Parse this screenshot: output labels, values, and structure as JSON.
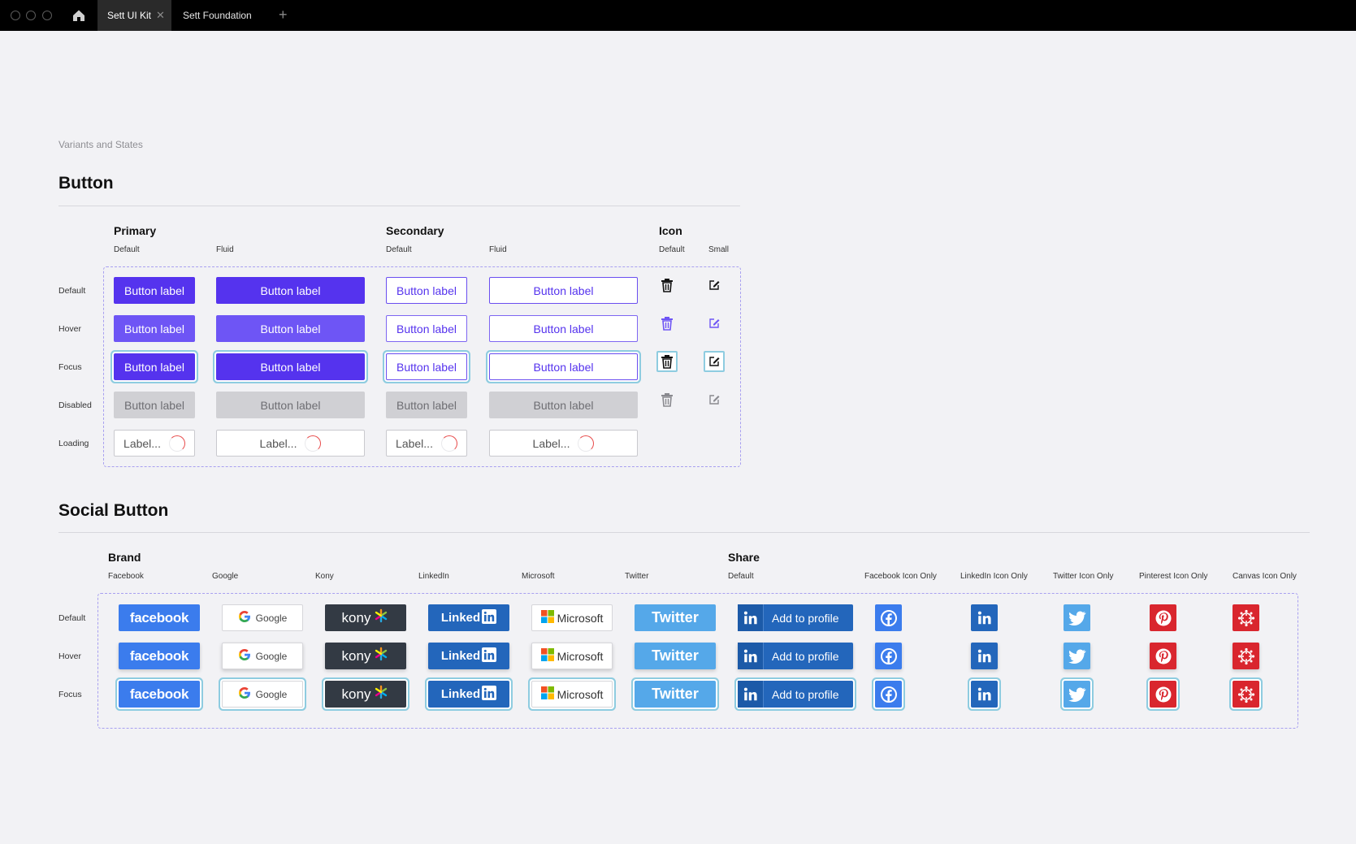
{
  "tabs": [
    {
      "label": "Sett UI Kit",
      "active": true
    },
    {
      "label": "Sett Foundation",
      "active": false
    }
  ],
  "breadcrumb": "Variants and States",
  "button_section": {
    "title": "Button",
    "groups": {
      "primary": "Primary",
      "secondary": "Secondary",
      "icon": "Icon"
    },
    "columns": {
      "default": "Default",
      "fluid": "Fluid",
      "small": "Small"
    },
    "rows": [
      "Default",
      "Hover",
      "Focus",
      "Disabled",
      "Loading"
    ],
    "label": "Button label",
    "loading_label": "Label..."
  },
  "social_section": {
    "title": "Social Button",
    "groups": {
      "brand": "Brand",
      "share": "Share"
    },
    "columns": [
      "Facebook",
      "Google",
      "Kony",
      "LinkedIn",
      "Microsoft",
      "Twitter",
      "Default",
      "Facebook Icon Only",
      "LinkedIn Icon Only",
      "Twitter Icon Only",
      "Pinterest Icon Only",
      "Canvas Icon Only"
    ],
    "rows": [
      "Default",
      "Hover",
      "Focus"
    ],
    "labels": {
      "facebook": "facebook",
      "google": "Google",
      "kony": "kony",
      "linkedin": "Linked",
      "microsoft": "Microsoft",
      "twitter": "Twitter",
      "share": "Add to profile"
    }
  },
  "colors": {
    "primary": "#5533ee",
    "focus_ring": "#8ecce0",
    "facebook": "#3b7ced",
    "linkedin": "#2366bb",
    "twitter": "#55a8e9",
    "pinterest": "#d9262e",
    "kony": "#333a44"
  }
}
